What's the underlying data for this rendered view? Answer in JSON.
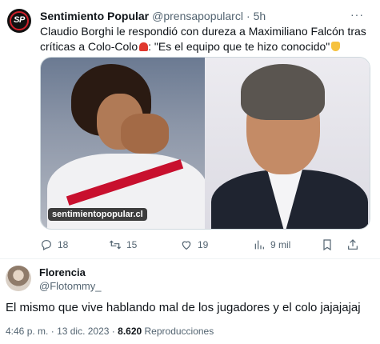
{
  "quoted_tweet": {
    "author_name": "Sentimiento Popular",
    "author_handle": "@prensapopularcl",
    "separator": "·",
    "time": "5h",
    "more": "···",
    "text_part1": "Claudio Borghi le respondió con dureza a Maximiliano Falcón tras críticas a Colo-Colo",
    "text_part2": ": \"Es el equipo que te hizo conocido\"",
    "avatar_text": "SP",
    "media_watermark": "sentimientopopular.cl",
    "actions": {
      "replies": "18",
      "retweets": "15",
      "likes": "19",
      "views": "9 mil"
    }
  },
  "reply": {
    "author_name": "Florencia",
    "author_handle": "@Flotommy_",
    "text": "El mismo que vive hablando mal de los jugadores y el colo jajajajaj",
    "time": "4:46 p. m.",
    "separator": "·",
    "date": "13 dic. 2023",
    "separator2": "·",
    "views_count": "8.620",
    "views_label": "Reproducciones"
  },
  "colors": {
    "text_primary": "#0f1419",
    "text_secondary": "#536471",
    "border": "#cfd9de",
    "brand_red": "#d0202a"
  },
  "icons": [
    "reply-icon",
    "retweet-icon",
    "like-icon",
    "views-icon",
    "bookmark-icon",
    "share-icon",
    "siren-emoji",
    "pointing-hand-emoji"
  ]
}
